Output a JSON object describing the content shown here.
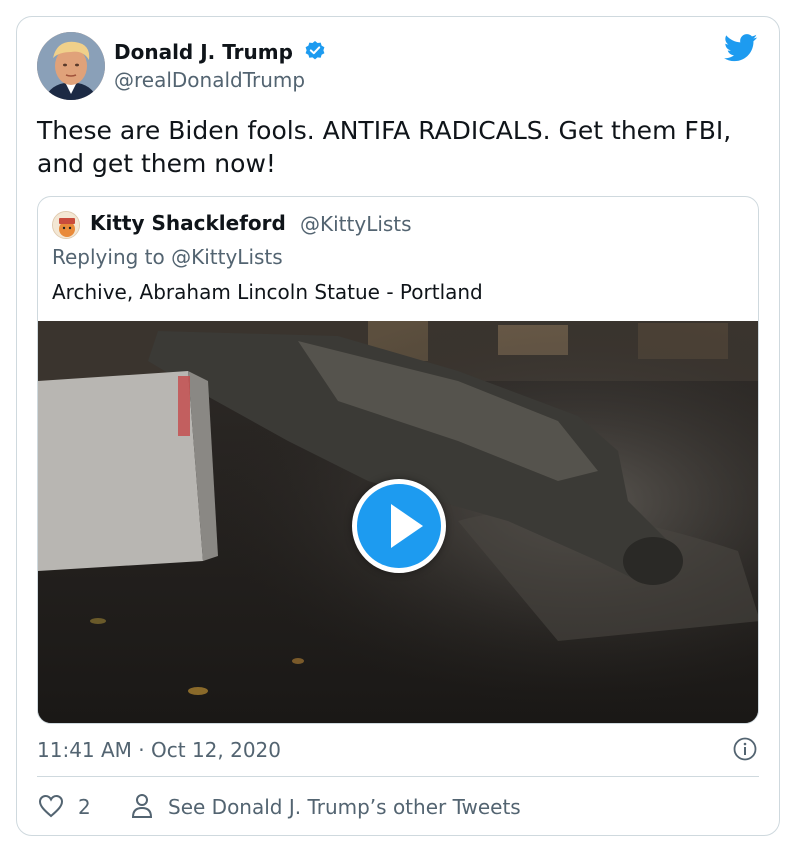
{
  "author": {
    "name": "Donald J. Trump",
    "handle": "@realDonaldTrump",
    "avatar_icon": "avatar-portrait"
  },
  "tweet": {
    "text": "These are Biden fools. ANTIFA RADICALS. Get them FBI, and get them now!",
    "timestamp": "11:41 AM · Oct 12, 2020",
    "like_count": "2",
    "see_more_label": "See Donald J. Trump’s other Tweets"
  },
  "quoted_tweet": {
    "name": "Kitty Shackleford",
    "handle": "@KittyLists",
    "replying_to": "Replying to @KittyLists",
    "text": "Archive, Abraham Lincoln Statue - Portland",
    "media_type": "video"
  },
  "colors": {
    "brand_blue": "#1d9bf0",
    "text_primary": "#0f1419",
    "text_secondary": "#536471",
    "border": "#cfd9de"
  },
  "icons": [
    "verified-badge-icon",
    "twitter-bird-icon",
    "play-icon",
    "info-icon",
    "heart-icon",
    "person-icon"
  ]
}
